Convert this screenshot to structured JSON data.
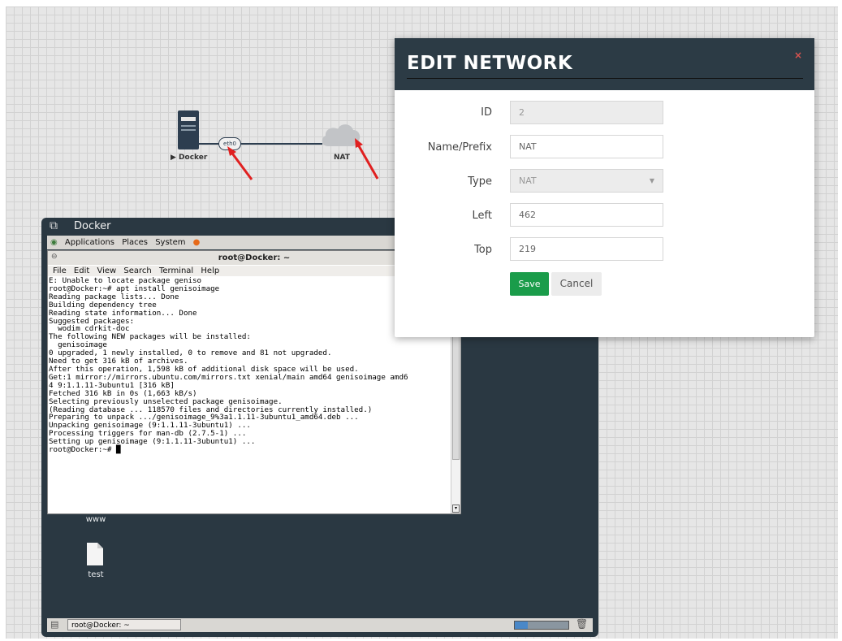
{
  "topology": {
    "docker_node_label": "▶ Docker",
    "interface_label": "eth0",
    "nat_node_label": "NAT"
  },
  "modal": {
    "title": "EDIT NETWORK",
    "close_label": "×",
    "fields": {
      "id_label": "ID",
      "id_value": "2",
      "name_label": "Name/Prefix",
      "name_value": "NAT",
      "type_label": "Type",
      "type_value": "NAT",
      "left_label": "Left",
      "left_value": "462",
      "top_label": "Top",
      "top_value": "219"
    },
    "save_label": "Save",
    "cancel_label": "Cancel"
  },
  "docker_window": {
    "title": "Docker",
    "panel_menu": [
      "Applications",
      "Places",
      "System"
    ],
    "terminal_title": "root@Docker: ~",
    "terminal_menu": [
      "File",
      "Edit",
      "View",
      "Search",
      "Terminal",
      "Help"
    ],
    "terminal_output": "E: Unable to locate package geniso\nroot@Docker:~# apt install genisoimage\nReading package lists... Done\nBuilding dependency tree\nReading state information... Done\nSuggested packages:\n  wodim cdrkit-doc\nThe following NEW packages will be installed:\n  genisoimage\n0 upgraded, 1 newly installed, 0 to remove and 81 not upgraded.\nNeed to get 316 kB of archives.\nAfter this operation, 1,598 kB of additional disk space will be used.\nGet:1 mirror://mirrors.ubuntu.com/mirrors.txt xenial/main amd64 genisoimage amd6\n4 9:1.1.11-3ubuntu1 [316 kB]\nFetched 316 kB in 0s (1,663 kB/s)\nSelecting previously unselected package genisoimage.\n(Reading database ... 118570 files and directories currently installed.)\nPreparing to unpack .../genisoimage_9%3a1.1.11-3ubuntu1_amd64.deb ...\nUnpacking genisoimage (9:1.1.11-3ubuntu1) ...\nProcessing triggers for man-db (2.7.5-1) ...\nSetting up genisoimage (9:1.1.11-3ubuntu1) ...\nroot@Docker:~# █",
    "desktop_icons": [
      "www",
      "test"
    ],
    "taskbar_item": "root@Docker: ~"
  },
  "colors": {
    "modal_header": "#2c3b45",
    "save_button": "#1a9c4a",
    "close_x": "#d9534f",
    "annotation_arrow": "#e02020",
    "docker_window_bg": "#2a3842"
  }
}
